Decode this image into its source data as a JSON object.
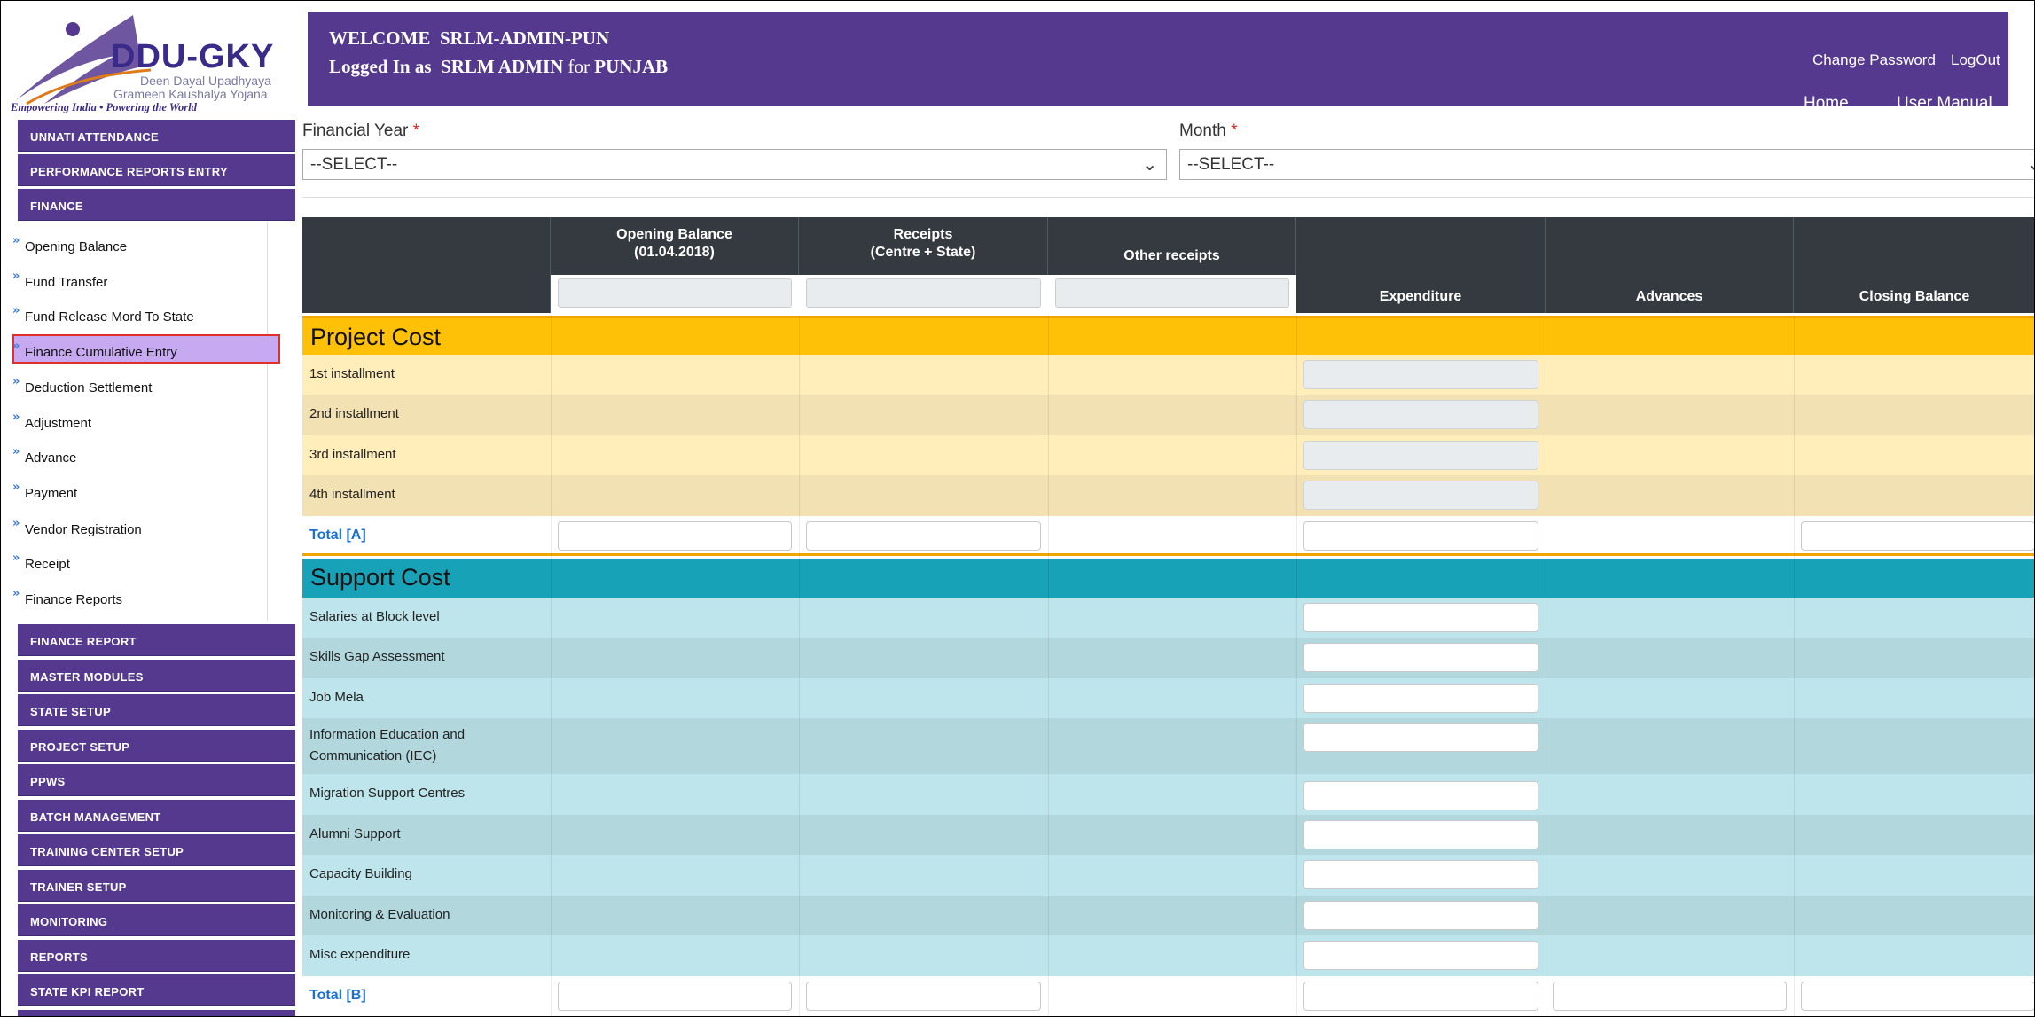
{
  "logo": {
    "title": "DDU-GKY",
    "subtitle_1": "Deen Dayal Upadhyaya",
    "subtitle_2": "Grameen Kaushalya Yojana",
    "tagline": "Empowering India • Powering the World"
  },
  "header": {
    "welcome_prefix": "WELCOME",
    "user_id": "SRLM-ADMIN-PUN",
    "logged_prefix": "Logged In as",
    "role": "SRLM ADMIN",
    "for_word": "for",
    "state": "PUNJAB",
    "links": {
      "change_password": "Change Password",
      "logout": "LogOut",
      "home": "Home",
      "user_manual": "User Manual"
    }
  },
  "sidebar": {
    "top_items": [
      "UNNATI ATTENDANCE",
      "PERFORMANCE REPORTS ENTRY",
      "FINANCE"
    ],
    "finance_items": [
      "Opening Balance",
      "Fund Transfer",
      "Fund Release Mord To State",
      "Finance Cumulative Entry",
      "Deduction Settlement",
      "Adjustment",
      "Advance",
      "Payment",
      "Vendor Registration",
      "Receipt",
      "Finance Reports"
    ],
    "active_item": "Finance Cumulative Entry",
    "bottom_items": [
      "FINANCE REPORT",
      "MASTER MODULES",
      "STATE SETUP",
      "PROJECT SETUP",
      "PPWS",
      "BATCH MANAGEMENT",
      "TRAINING CENTER SETUP",
      "TRAINER SETUP",
      "MONITORING",
      "REPORTS",
      "STATE KPI REPORT"
    ]
  },
  "filters": {
    "financial_year": {
      "label": "Financial Year",
      "value": "--SELECT--"
    },
    "month": {
      "label": "Month",
      "value": "--SELECT--"
    },
    "required_mark": "*"
  },
  "table": {
    "headers": {
      "opening_balance_1": "Opening Balance",
      "opening_balance_2": "(01.04.2018)",
      "receipts_1": "Receipts",
      "receipts_2": "(Centre + State)",
      "other_receipts": "Other receipts",
      "expenditure": "Expenditure",
      "advances": "Advances",
      "closing_balance": "Closing Balance"
    },
    "project_cost": {
      "title": "Project Cost",
      "rows": [
        "1st installment",
        "2nd installment",
        "3rd installment",
        "4th installment"
      ],
      "total": "Total [A]"
    },
    "support_cost": {
      "title": "Support Cost",
      "rows": [
        "Salaries at Block level",
        "Skills Gap Assessment",
        "Job Mela",
        "Information Education and",
        "Communication (IEC)",
        "Migration Support Centres",
        "Alumni Support",
        "Capacity Building",
        "Monitoring & Evaluation",
        "Misc expenditure"
      ],
      "total": "Total [B]"
    }
  },
  "colors": {
    "header_purple": "#55398f",
    "project_section": "#ffc107",
    "support_section": "#17a2b8",
    "active_highlight": "#c6a9f0",
    "total_label": "#1a6fd6"
  }
}
